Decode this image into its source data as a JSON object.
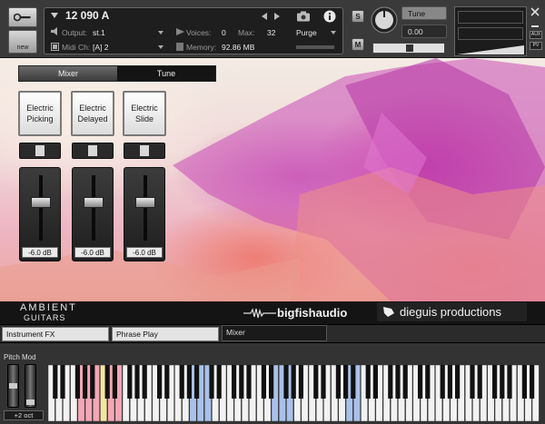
{
  "header": {
    "instrument": {
      "index_name": "12 090 A",
      "output_label": "Output:",
      "output_value": "st.1",
      "voices_label": "Voices:",
      "voices_value": "0",
      "max_label": "Max:",
      "max_value": "32",
      "midi_label": "Midi Ch:",
      "midi_value": "[A]  2",
      "memory_label": "Memory:",
      "memory_value": "92.86 MB",
      "purge_label": "Purge"
    },
    "new_label": "new",
    "solo_label": "S",
    "mute_label": "M",
    "tune_label": "Tune",
    "tune_value": "0.00",
    "aux_label": "AUX",
    "pv_label": "PV"
  },
  "mixer": {
    "tabs": [
      "Mixer",
      "Tune"
    ],
    "channels": [
      {
        "label": "Electric Picking",
        "db": "-6.0 dB",
        "level": 0.55
      },
      {
        "label": "Electric Delayed",
        "db": "-6.0 dB",
        "level": 0.55
      },
      {
        "label": "Electric Slide",
        "db": "-6.0 dB",
        "level": 0.55
      }
    ]
  },
  "branding": {
    "product_line1": "AMBIENT",
    "product_line2": "GUITARS",
    "partner1": "bigfishaudio",
    "partner2": "dieguis productions"
  },
  "bottom_tabs": [
    "Instrument FX",
    "Phrase Play",
    "Mixer"
  ],
  "keyboard": {
    "pitch_mod_label": "Pitch Mod",
    "octave_label": "+2 oct",
    "colors": {
      "pink": "#f4a6b6",
      "yellow": "#f2e7a0",
      "blue": "#a9c1ea"
    }
  }
}
